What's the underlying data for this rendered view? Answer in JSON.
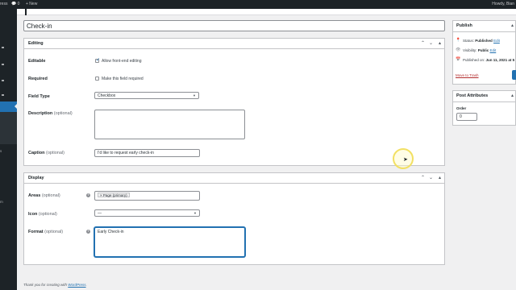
{
  "admin_bar": {
    "site": "ress",
    "comments": "0",
    "new": "+ New",
    "howdy": "Howdy, Bian"
  },
  "title_field": {
    "value": "Check-in"
  },
  "editing": {
    "title": "Editing",
    "editable": {
      "label": "Editable",
      "checkbox_label": "Allow front-end editing",
      "checked": true
    },
    "required": {
      "label": "Required",
      "checkbox_label": "Make this field required",
      "checked": false
    },
    "field_type": {
      "label": "Field Type",
      "value": "Checkbox"
    },
    "description": {
      "label": "Description",
      "optional": "(optional)",
      "value": ""
    },
    "caption": {
      "label": "Caption",
      "optional": "(optional)",
      "value": "I'd like to request early check-in"
    }
  },
  "display": {
    "title": "Display",
    "areas": {
      "label": "Areas",
      "optional": "(optional)",
      "tag": "× Page (primary)"
    },
    "icon": {
      "label": "Icon",
      "optional": "(optional)",
      "value": "—"
    },
    "format": {
      "label": "Format",
      "optional": "(optional)",
      "value": "Early Check-in"
    }
  },
  "publish": {
    "title": "Publish",
    "status_label": "Status:",
    "status_value": "Published",
    "status_edit": "Edit",
    "visibility_label": "Visibility:",
    "visibility_value": "Public",
    "visibility_edit": "Edit",
    "published_label": "Published on:",
    "published_value": "Jun 11, 2021 at 5",
    "trash": "Move to Trash"
  },
  "post_attributes": {
    "title": "Post Attributes",
    "order_label": "Order",
    "order_value": "0"
  },
  "footer": {
    "text": "Thank you for creating with ",
    "link": "WordPress",
    "end": "."
  },
  "sidebar": {
    "items": [
      "s",
      "m"
    ]
  },
  "colors": {
    "accent": "#2271b1",
    "admin_bg": "#1d2327",
    "page_bg": "#f0f0f1"
  }
}
